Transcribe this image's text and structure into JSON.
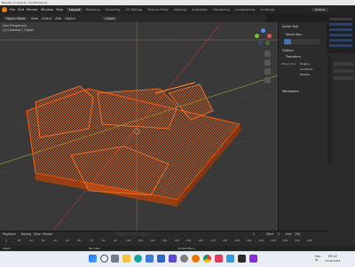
{
  "window": {
    "title": "Blender [C:\\Users\\...\\model.blend]"
  },
  "topbar": {
    "menus": [
      "File",
      "Edit",
      "Render",
      "Window",
      "Help"
    ],
    "workspaces": [
      "Layout",
      "Modeling",
      "Sculpting",
      "UV Editing",
      "Texture Paint",
      "Shading",
      "Animation",
      "Rendering",
      "Compositing",
      "Scripting"
    ],
    "active_workspace": "Layout",
    "scene_label": "Scene"
  },
  "viewport_header": {
    "items": [
      "Object Mode",
      "View",
      "Select",
      "Add",
      "Object"
    ],
    "orientation": "Global"
  },
  "viewport": {
    "info_line1": "User Perspective",
    "info_line2": "(1) Collection | Object"
  },
  "npanel": {
    "active_tool_title": "Active Tool",
    "select_box": "Select Box",
    "options_title": "Options",
    "transform_title": "Transform",
    "affect_only": "Affect Only",
    "origins": "Origins",
    "locations": "Locations",
    "parents": "Parents",
    "workspace_title": "Workspace"
  },
  "timeline": {
    "playback": "Playback",
    "keying": "Keying",
    "view": "View",
    "marker": "Marker",
    "current_frame": "1",
    "start_label": "Start",
    "start": "1",
    "end_label": "End",
    "end": "250",
    "ticks": [
      "0",
      "10",
      "20",
      "30",
      "40",
      "50",
      "60",
      "70",
      "80",
      "90",
      "100",
      "110",
      "120",
      "130",
      "140",
      "150",
      "160",
      "170",
      "180",
      "190",
      "200",
      "210",
      "220",
      "230",
      "240",
      "250"
    ]
  },
  "statusbar": {
    "select": "Select",
    "pan": "Pan View",
    "context": "Context Menu"
  },
  "taskbar": {
    "time": "09:12",
    "date": "24-06-2024",
    "lang": "ENG\nIN"
  },
  "colors": {
    "wireframe": "#ff5a0a",
    "accent": "#4772b3",
    "viewport_bg": "#393939"
  }
}
